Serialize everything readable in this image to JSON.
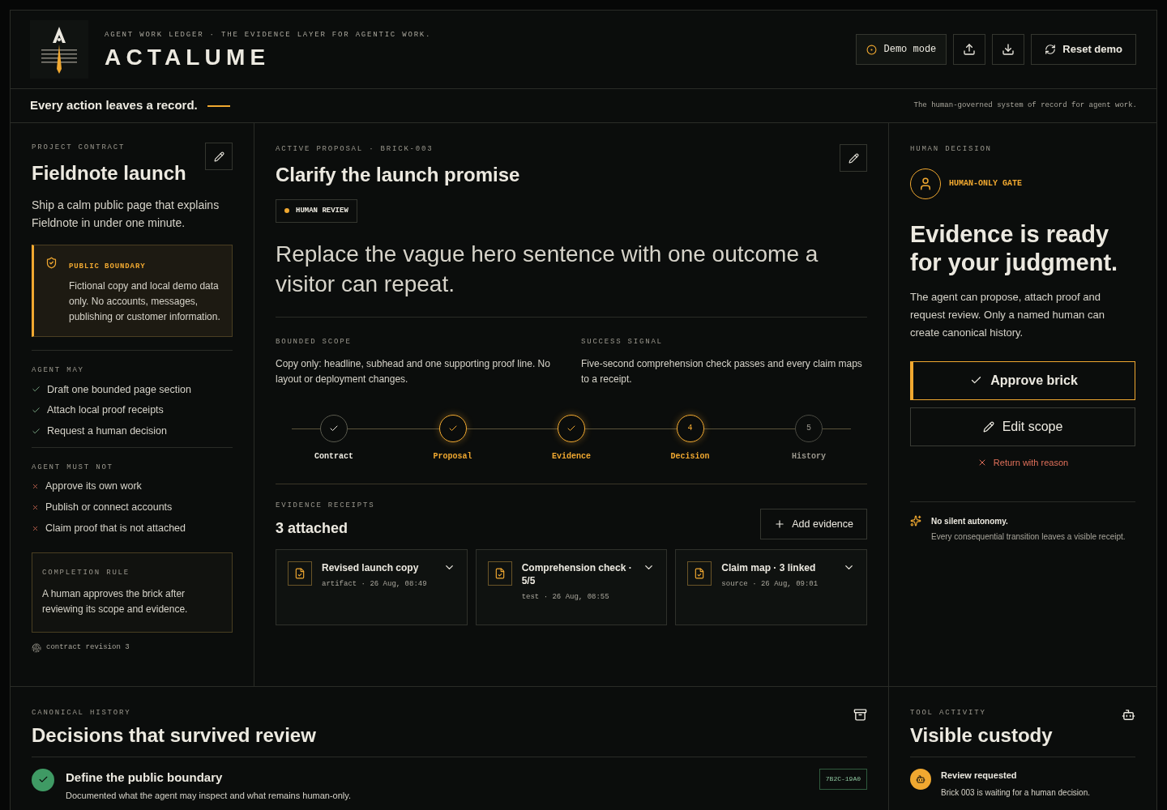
{
  "header": {
    "subtitle": "AGENT WORK LEDGER · THE EVIDENCE LAYER FOR AGENTIC WORK.",
    "brand": "ACTALUME",
    "buttons": [
      {
        "kind": "demo",
        "label": "Demo mode"
      },
      {
        "kind": "upload"
      },
      {
        "kind": "download"
      },
      {
        "kind": "reset",
        "label": "Reset demo"
      }
    ]
  },
  "tagline": {
    "text": "Every action leaves a record.",
    "note": "The human-governed system of record for agent work."
  },
  "contract": {
    "eyebrow": "PROJECT CONTRACT",
    "title": "Fieldnote launch",
    "description": "Ship a calm public page that explains Fieldnote in under one minute.",
    "boundary": {
      "title": "PUBLIC BOUNDARY",
      "text": "Fictional copy and local demo data only. No accounts, messages, publishing or customer information."
    },
    "may": {
      "heading": "AGENT MAY",
      "items": [
        "Draft one bounded page section",
        "Attach local proof receipts",
        "Request a human decision"
      ]
    },
    "must_not": {
      "heading": "AGENT MUST NOT",
      "items": [
        "Approve its own work",
        "Publish or connect accounts",
        "Claim proof that is not attached"
      ]
    },
    "completion": {
      "heading": "COMPLETION RULE",
      "text": "A human approves the brick after reviewing its scope and evidence."
    },
    "revision": "contract revision 3"
  },
  "proposal": {
    "eyebrow": "ACTIVE PROPOSAL · BRICK-003",
    "title": "Clarify the launch promise",
    "badge": "HUMAN REVIEW",
    "statement": "Replace the vague hero sentence with one outcome a visitor can repeat.",
    "scope": {
      "heading": "BOUNDED SCOPE",
      "text": "Copy only: headline, subhead and one supporting proof line. No layout or deployment changes."
    },
    "signal": {
      "heading": "SUCCESS SIGNAL",
      "text": "Five-second comprehension check passes and every claim maps to a receipt."
    },
    "steps": [
      {
        "label": "Contract",
        "done": true,
        "active": false
      },
      {
        "label": "Proposal",
        "done": true,
        "active": true
      },
      {
        "label": "Evidence",
        "done": true,
        "active": true
      },
      {
        "label": "Decision",
        "done": false,
        "active": true,
        "number": "4"
      },
      {
        "label": "History",
        "done": false,
        "active": false,
        "number": "5"
      }
    ],
    "evidence": {
      "eyebrow": "EVIDENCE RECEIPTS",
      "count": "3 attached",
      "add_label": "Add evidence",
      "receipts": [
        {
          "title": "Revised launch copy",
          "meta": "artifact · 26 Aug, 08:49"
        },
        {
          "title": "Comprehension check · 5/5",
          "meta": "test · 26 Aug, 08:55"
        },
        {
          "title": "Claim map · 3 linked",
          "meta": "source · 26 Aug, 09:01"
        }
      ]
    }
  },
  "decision": {
    "eyebrow": "HUMAN DECISION",
    "gate": "HUMAN-ONLY GATE",
    "headline": "Evidence is ready for your judgment.",
    "body": "The agent can propose, attach proof and request review. Only a named human can create canonical history.",
    "approve": "Approve brick",
    "edit": "Edit scope",
    "return": "Return with reason",
    "note": {
      "title": "No silent autonomy.",
      "text": "Every consequential transition leaves a visible receipt."
    }
  },
  "history": {
    "eyebrow": "CANONICAL HISTORY",
    "title": "Decisions that survived review",
    "entries": [
      {
        "title": "Define the public boundary",
        "text": "Documented what the agent may inspect and what remains human-only.",
        "hash": "7B2C-19A0"
      }
    ]
  },
  "activity": {
    "eyebrow": "TOOL ACTIVITY",
    "title": "Visible custody",
    "entries": [
      {
        "title": "Review requested",
        "text": "Brick 003 is waiting for a human decision."
      }
    ]
  }
}
